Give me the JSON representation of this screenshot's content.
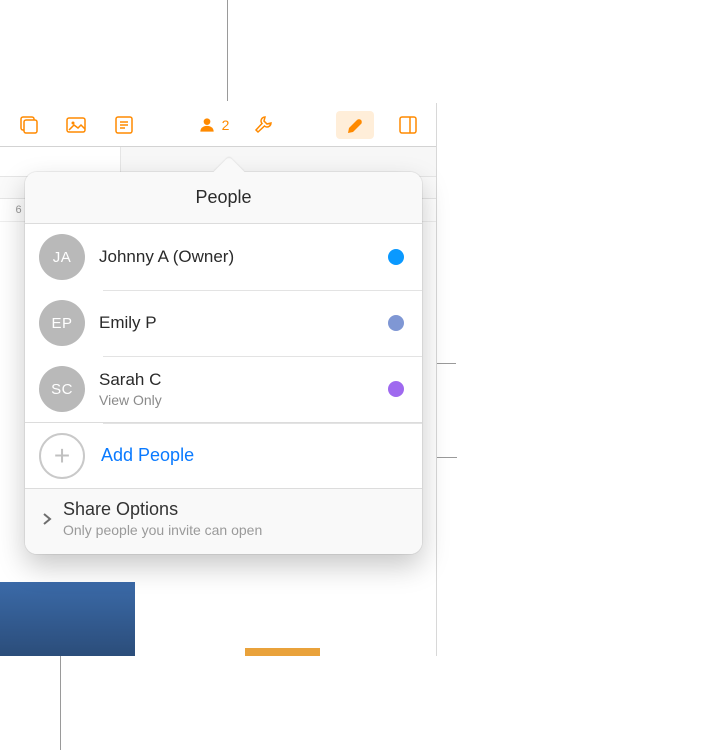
{
  "toolbar": {
    "participant_count": "2"
  },
  "sheet": {
    "visible_row_header": "6"
  },
  "popover": {
    "title": "People",
    "participants": [
      {
        "initials": "JA",
        "display_name": "Johnny A (Owner)",
        "dot_color": "#0a99ff",
        "dot_style": "background:#0a99ff"
      },
      {
        "initials": "EP",
        "display_name": "Emily P",
        "dot_color": "#7f97d4",
        "dot_style": "background:#7f97d4"
      },
      {
        "initials": "SC",
        "display_name": "Sarah C",
        "permission": "View Only",
        "dot_color": "#9f69ef",
        "dot_style": "background:#9f69ef"
      }
    ],
    "add_people_label": "Add People",
    "share_options": {
      "title": "Share Options",
      "subtitle": "Only people you invite can open"
    }
  }
}
